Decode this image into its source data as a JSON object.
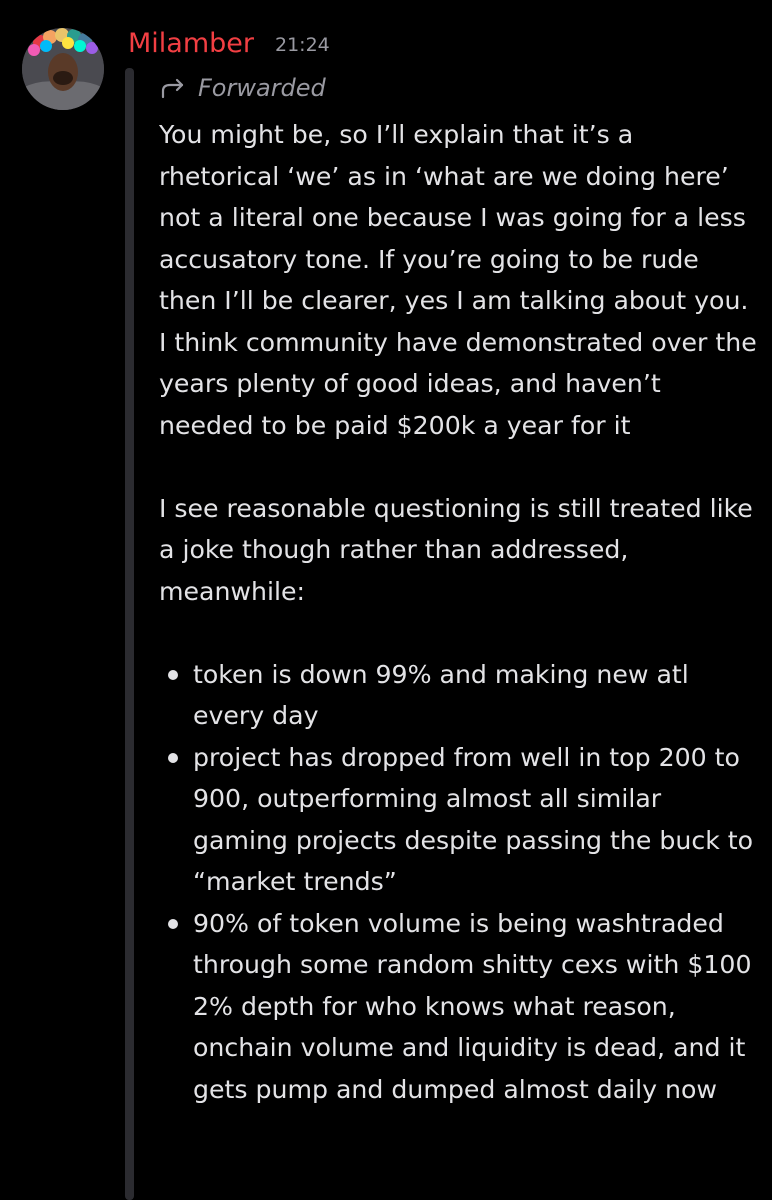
{
  "message": {
    "author": {
      "name": "Milamber",
      "name_color": "#f23f43",
      "avatar": "avatar-image"
    },
    "timestamp": "21:24",
    "forwarded_label": "Forwarded",
    "forwarded_icon": "forward-arrow-icon",
    "paragraphs": [
      "You might be, so I’ll explain that it’s a rhetorical ‘we’ as in ‘what are we doing here’ not a literal one because I was going for a less accusatory tone. If you’re going to be rude then I’ll be clearer, yes I am talking about you. I think community have demonstrated over the years plenty of good ideas, and haven’t needed to be paid $200k a year for it",
      "I see reasonable questioning is still treated like a joke though rather than addressed, meanwhile:"
    ],
    "bullets": [
      "token is down 99% and making new atl every day",
      "project has dropped from well in top 200 to 900, outperforming almost all similar gaming projects despite passing the buck to “market trends”",
      "90% of token volume is being washtraded through some random shitty cexs with $100 2% depth for who knows what reason, onchain volume and liquidity is dead, and it gets pump and dumped almost daily now"
    ]
  }
}
